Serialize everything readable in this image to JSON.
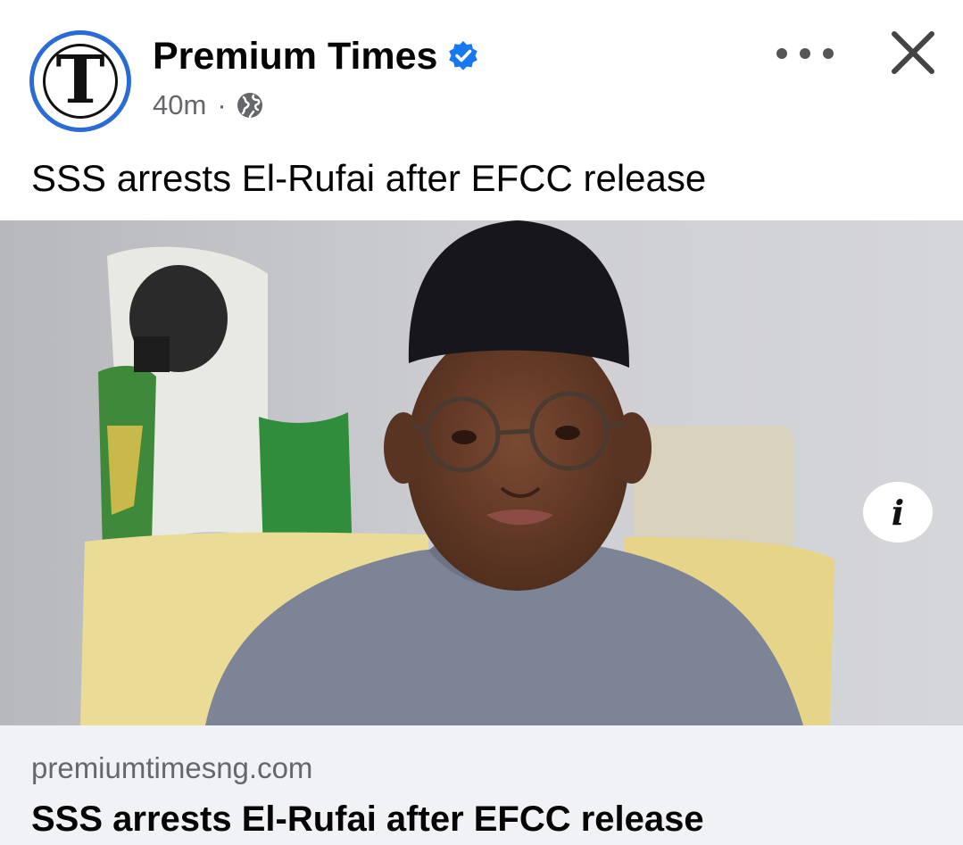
{
  "post": {
    "page_name": "Premium Times",
    "time": "40m",
    "separator": "·",
    "text": "SSS arrests El-Rufai after EFCC release",
    "logo_letter": "T"
  },
  "link_preview": {
    "domain": "premiumtimesng.com",
    "title": "SSS arrests El-Rufai after EFCC release"
  },
  "icons": {
    "verified": "verified-badge-icon",
    "audience": "globe-icon",
    "more": "more-options-icon",
    "close": "close-icon",
    "info": "info-icon",
    "info_glyph": "i"
  },
  "colors": {
    "verified": "#1877f2",
    "logo_ring": "#2a6bd6",
    "logo_accent": "#d0202a",
    "secondary_text": "#65676b",
    "link_background": "#f0f2f5"
  }
}
